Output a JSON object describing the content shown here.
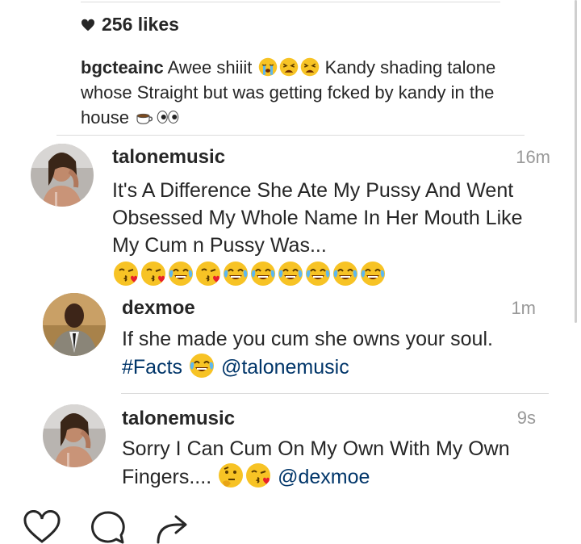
{
  "likes": {
    "count_text": "256 likes"
  },
  "caption": {
    "username": "bgcteainc",
    "text_1": "Awee shiiit",
    "text_2": "Kandy shading talone whose Straight but was getting fcked by kandy in the house",
    "emojis_1": [
      "crying-face",
      "weary-face",
      "weary-face"
    ],
    "emojis_2": [
      "tea-cup",
      "eyes"
    ]
  },
  "comments": [
    {
      "username": "talonemusic",
      "time": "16m",
      "text": "It's A Difference She Ate My Pussy And Went Obsessed My Whole Name In Her Mouth Like My Cum n Pussy Was...",
      "emojis": [
        "face-blowing-kiss",
        "face-blowing-kiss",
        "tears-of-joy",
        "face-blowing-kiss",
        "tears-of-joy",
        "tears-of-joy",
        "tears-of-joy",
        "tears-of-joy",
        "tears-of-joy",
        "tears-of-joy"
      ]
    },
    {
      "username": "dexmoe",
      "time": "1m",
      "text": "If she made you cum she owns your soul.",
      "hashtag": "#Facts",
      "mention": "@talonemusic",
      "emojis": [
        "tears-of-joy"
      ]
    },
    {
      "username": "talonemusic",
      "time": "9s",
      "text": "Sorry I Can Cum On My Own With My Own Fingers....",
      "mention": "@dexmoe",
      "emojis": [
        "thinking-face",
        "face-blowing-kiss"
      ]
    }
  ],
  "actions": [
    "like-icon",
    "comment-icon",
    "share-icon"
  ]
}
